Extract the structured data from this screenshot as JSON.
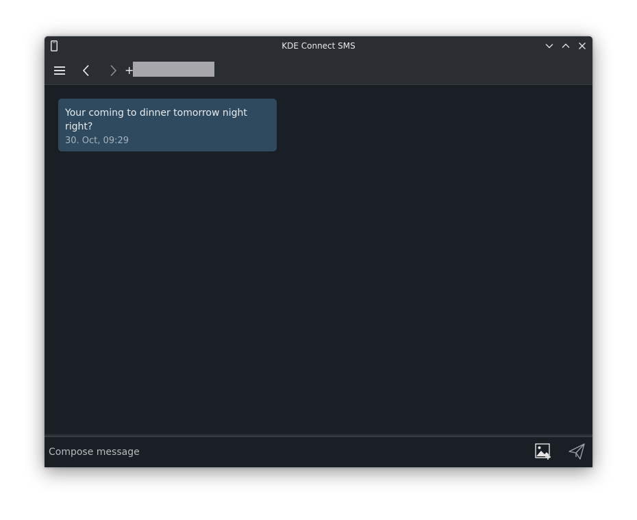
{
  "window": {
    "title": "KDE Connect SMS",
    "app_icon": "phone-icon",
    "controls": [
      "minimize-icon",
      "maximize-icon",
      "close-icon"
    ]
  },
  "toolbar": {
    "menu_icon": "hamburger-menu-icon",
    "back_icon": "chevron-left-icon",
    "forward_icon": "chevron-right-icon",
    "contact_prefix": "+"
  },
  "conversation": {
    "messages": [
      {
        "text": "Your coming to dinner tomorrow night right?",
        "timestamp": "30. Oct, 09:29"
      }
    ]
  },
  "compose": {
    "placeholder": "Compose message",
    "value": "",
    "attach_icon": "add-image-icon",
    "send_icon": "send-icon"
  },
  "colors": {
    "background": "#1a1e25",
    "header": "#2a2e32",
    "bubble": "#2f4a5e",
    "text": "#e7ebee",
    "muted": "#a7b3bc"
  }
}
